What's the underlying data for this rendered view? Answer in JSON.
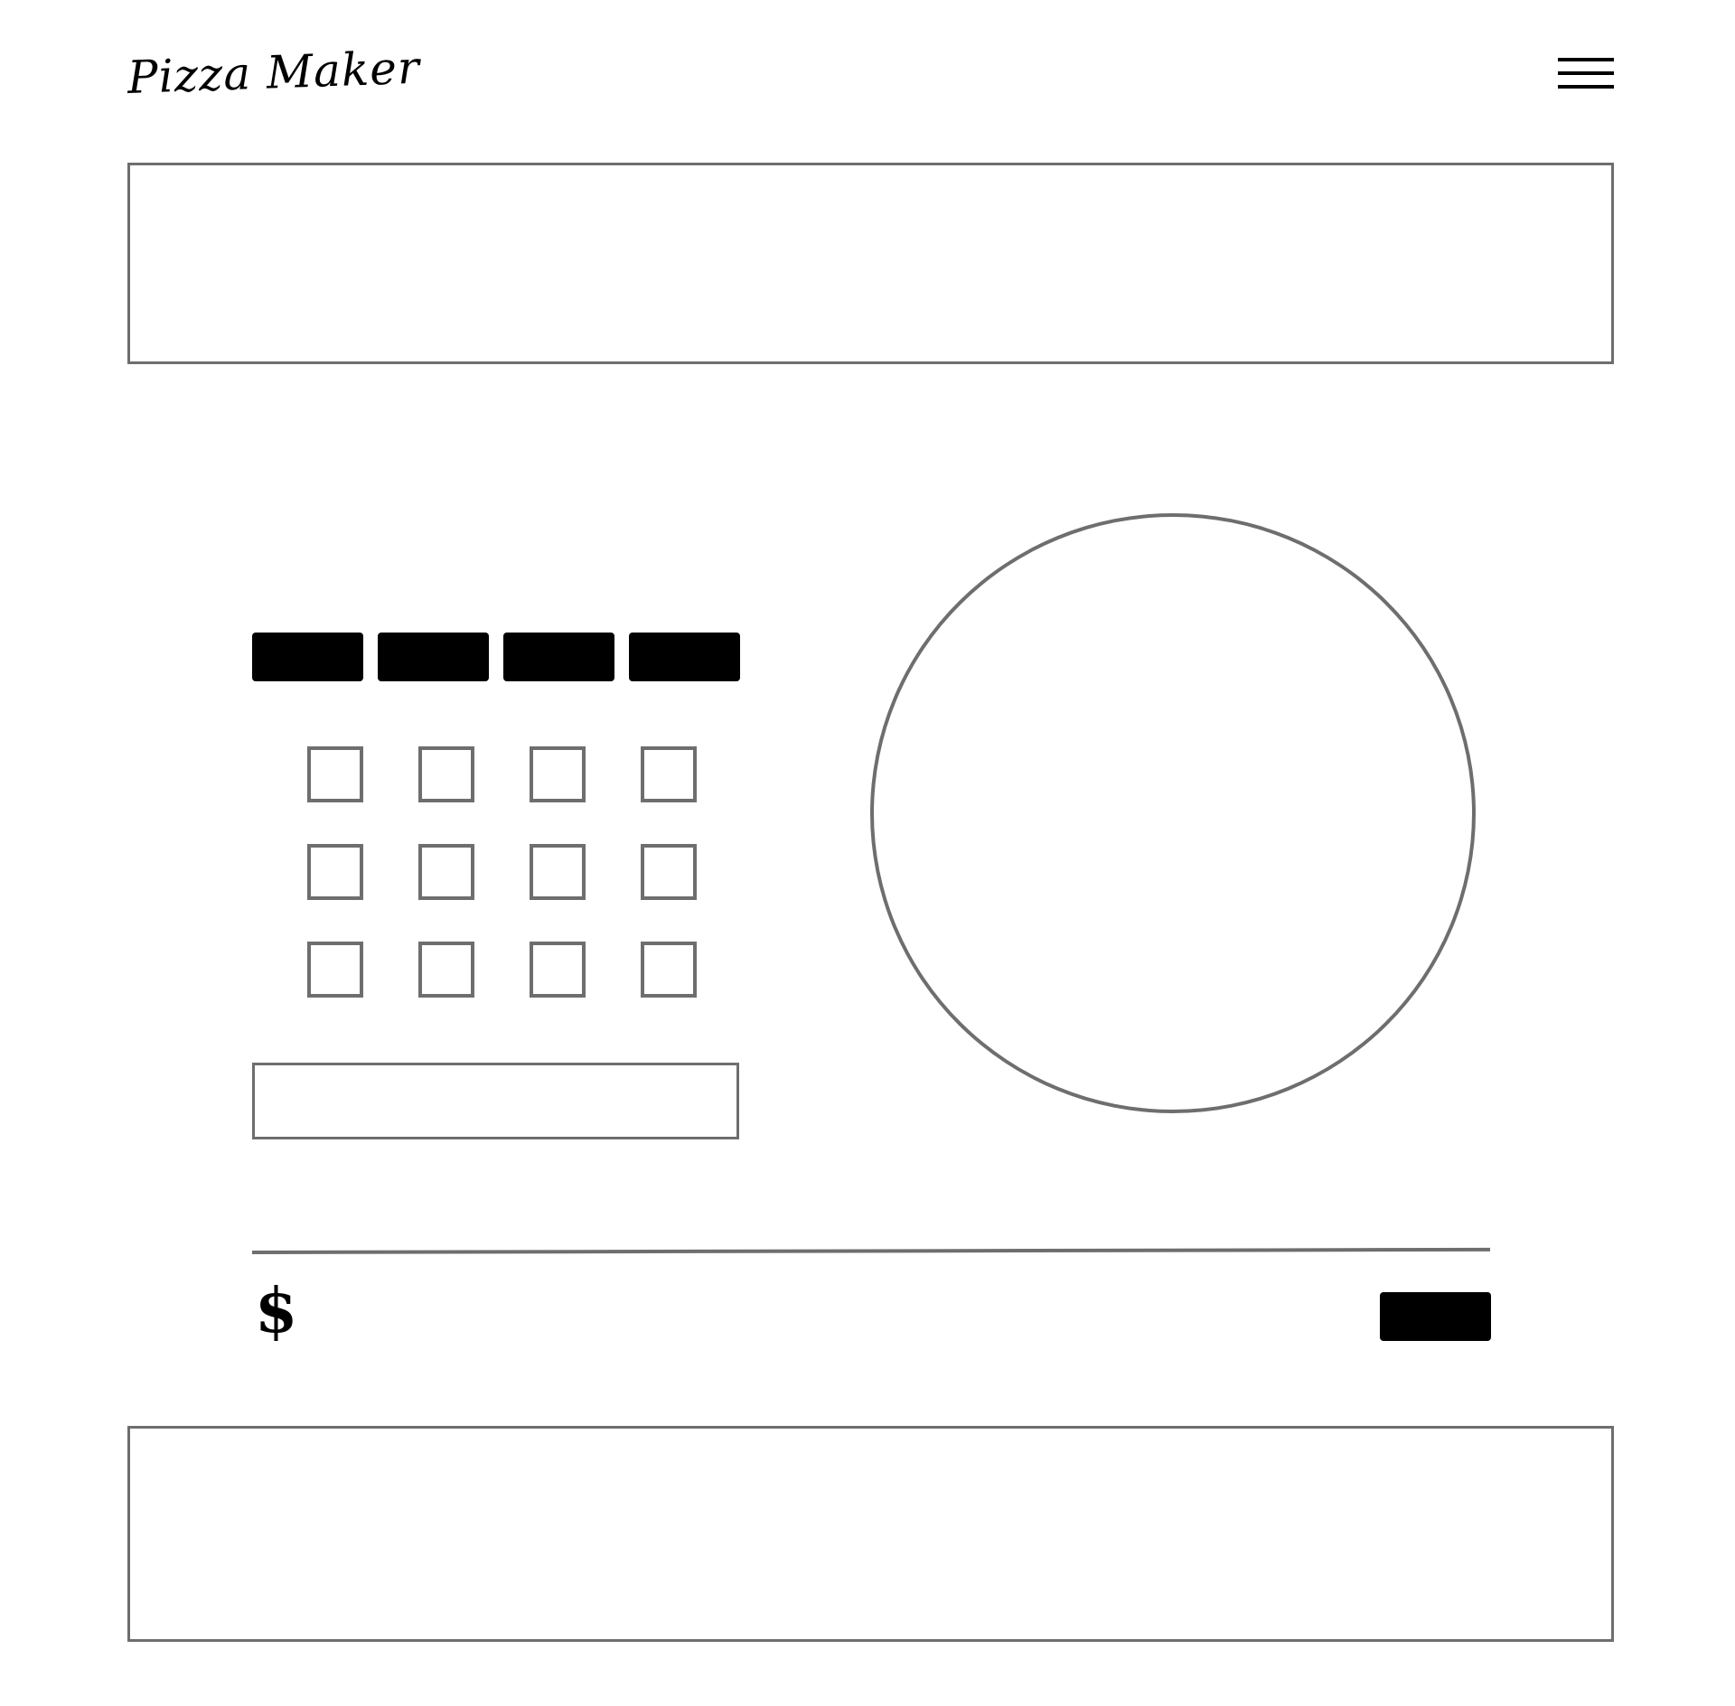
{
  "header": {
    "logo_text": "Pizza Maker",
    "menu_icon": "hamburger-menu-icon"
  },
  "builder": {
    "size_tabs": [
      "",
      "",
      "",
      ""
    ],
    "toppings": {
      "rows": 3,
      "columns": 4,
      "checked": [
        false,
        false,
        false,
        false,
        false,
        false,
        false,
        false,
        false,
        false,
        false,
        false
      ]
    },
    "notes": {
      "value": "",
      "placeholder": ""
    }
  },
  "summary": {
    "currency_symbol": "$",
    "price": "",
    "order_button_label": ""
  },
  "colors": {
    "border": "#6e6e6e",
    "button_bg": "#000000",
    "background": "#ffffff"
  }
}
